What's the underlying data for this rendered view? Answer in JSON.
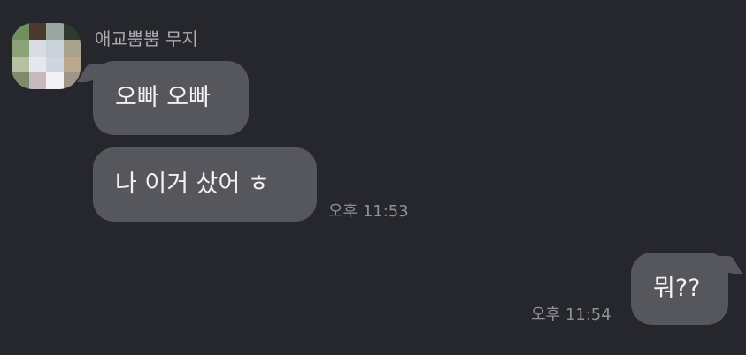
{
  "chat": {
    "sender": {
      "name": "애교뿜뿜 무지",
      "avatar_colors": [
        "#6f8f5e",
        "#4b3a2c",
        "#9aa7a0",
        "#2f3a2e",
        "#8aa277",
        "#d8dde3",
        "#c9d2d8",
        "#a8a48b",
        "#b9bfa3",
        "#e5e8ec",
        "#cfd6de",
        "#bba88f",
        "#7e8a6c",
        "#c7b8bd",
        "#f2f2f4",
        "#9e9586"
      ]
    },
    "messages": [
      {
        "direction": "incoming",
        "text": "오빠 오빠"
      },
      {
        "direction": "incoming",
        "text": "나 이거 샀어 ㅎ",
        "time": "오후 11:53"
      },
      {
        "direction": "outgoing",
        "text": "뭐??",
        "time": "오후 11:54"
      }
    ]
  },
  "colors": {
    "background": "#26272c",
    "bubble": "#56575d",
    "bubble_text": "#f1f1f3",
    "name_text": "#a9aab0",
    "timestamp_text": "#8f9096"
  }
}
